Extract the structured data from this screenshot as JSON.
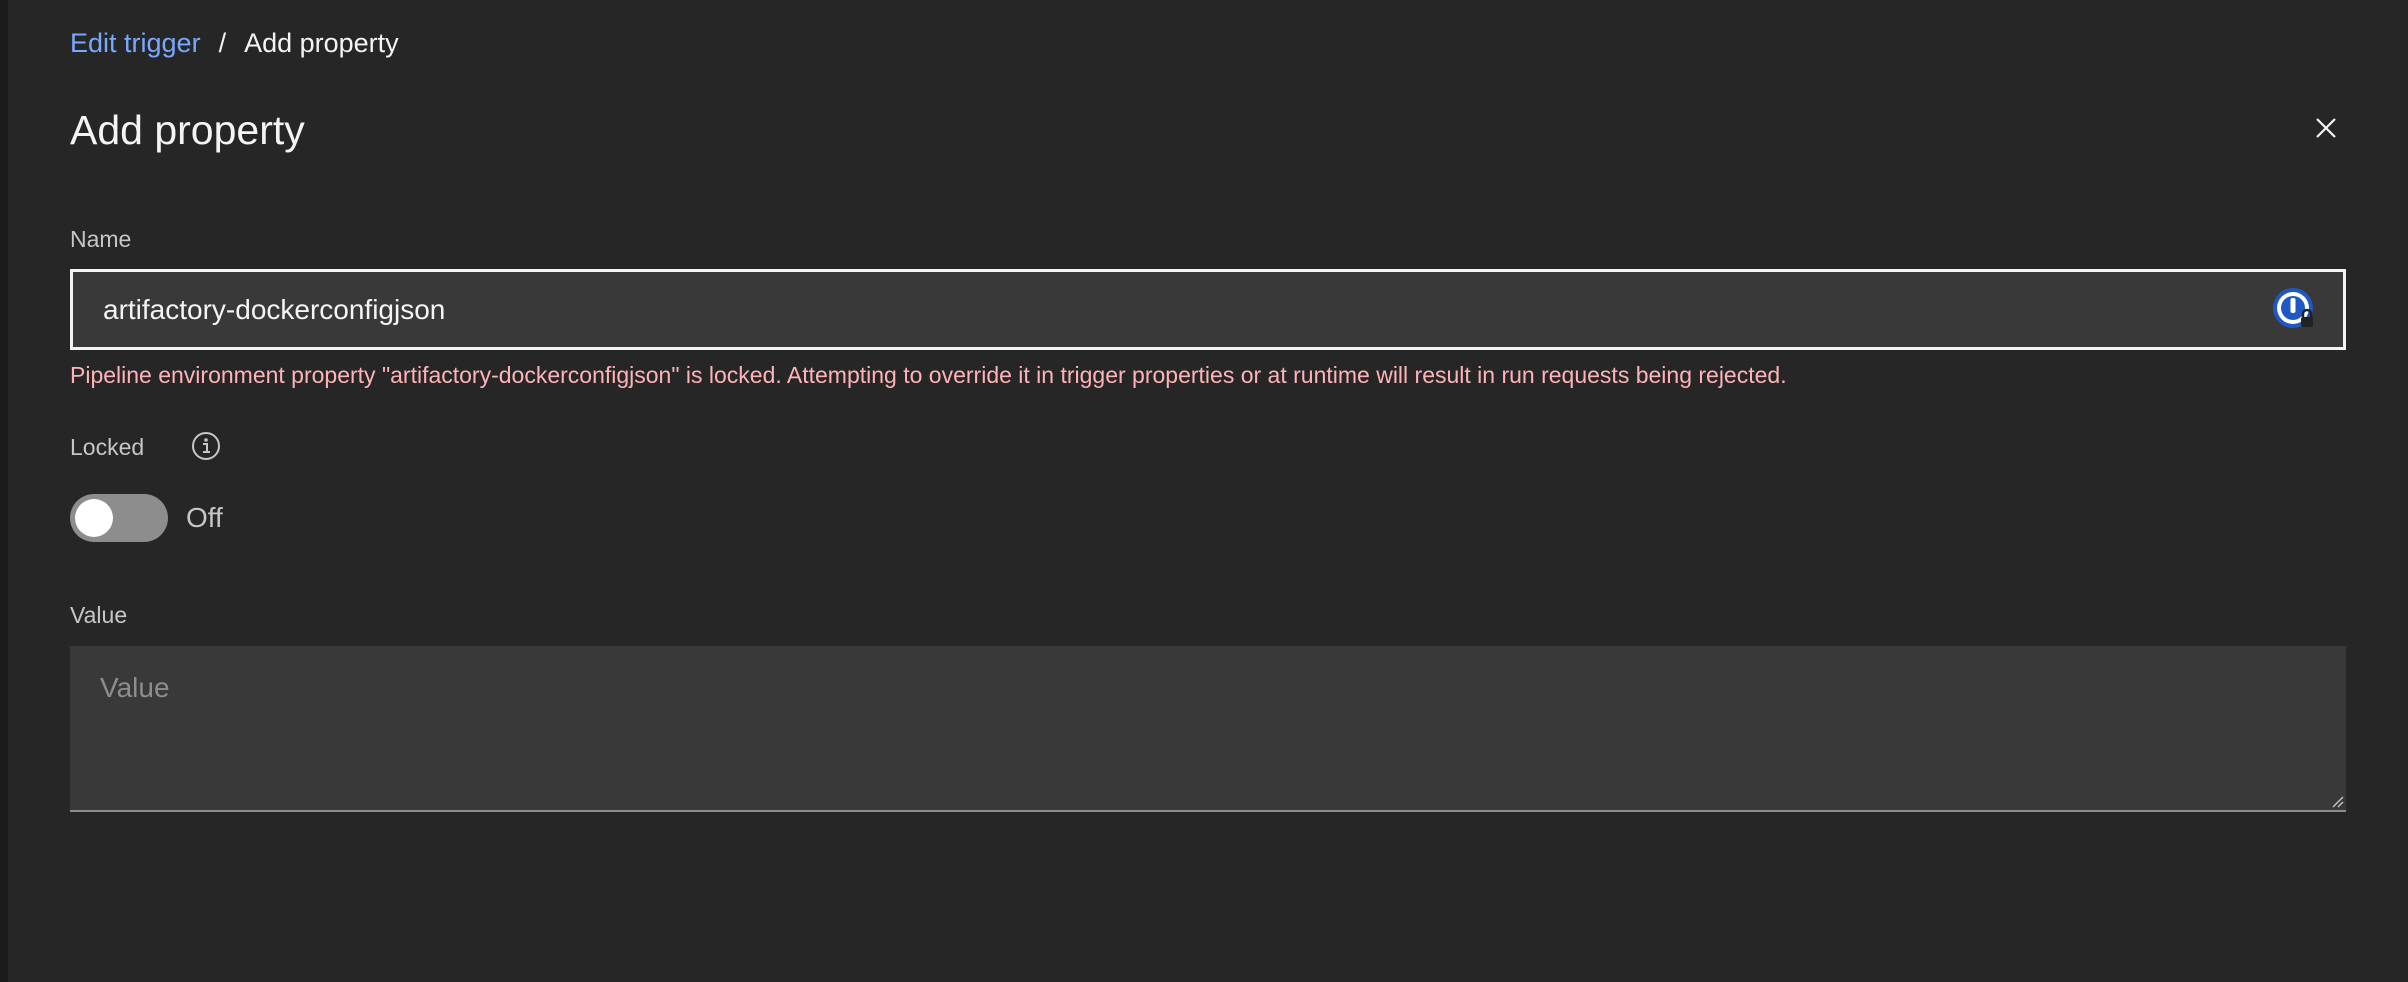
{
  "breadcrumb": {
    "parent": "Edit trigger",
    "separator": "/",
    "current": "Add property"
  },
  "title": "Add property",
  "icons": {
    "close": "close-icon",
    "password_manager": "password-manager-icon",
    "info": "info-icon"
  },
  "name_field": {
    "label": "Name",
    "value": "artifactory-dockerconfigjson",
    "error": "Pipeline environment property \"artifactory-dockerconfigjson\" is locked. Attempting to override it in trigger properties or at runtime will result in run requests being rejected."
  },
  "locked_field": {
    "label": "Locked",
    "state_text": "Off"
  },
  "value_field": {
    "label": "Value",
    "placeholder": "Value"
  },
  "colors": {
    "background": "#262626",
    "link": "#78a9ff",
    "error": "#ffb3b8",
    "input_bg": "#393939"
  }
}
